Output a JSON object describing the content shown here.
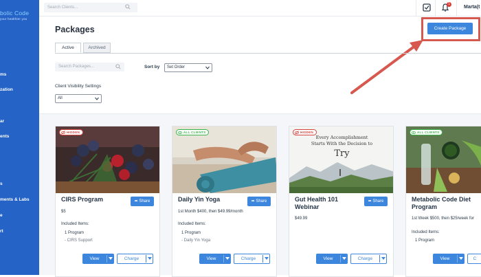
{
  "brand": {
    "logo_text": "bolic Code",
    "tagline": "your healthier you",
    "accent": "#3d86dd",
    "sidebar_color": "#2563c7",
    "annotation_color": "#d6584e"
  },
  "sidebar": {
    "items": [
      {
        "label": "ms"
      },
      {
        "label": "zation"
      },
      {
        "label": "ar"
      },
      {
        "label": "ents"
      },
      {
        "label": "s"
      },
      {
        "label": "ments & Labs"
      },
      {
        "label": "e"
      },
      {
        "label": "rt"
      }
    ]
  },
  "topbar": {
    "search_placeholder": "Search Clients...",
    "notification_count": "1",
    "user_name": "Marta(t"
  },
  "page": {
    "title": "Packages",
    "create_button": "Create Package"
  },
  "tabs": [
    {
      "label": "Active"
    },
    {
      "label": "Archived"
    }
  ],
  "filters": {
    "search_placeholder": "Search Packages...",
    "sort_label": "Sort by",
    "sort_value": "Set Order",
    "visibility_label": "Client Visibility Settings",
    "visibility_value": "All"
  },
  "cards": [
    {
      "badge": "HIDDEN",
      "badge_type": "hidden",
      "title": "CIRS Program",
      "price": "$5",
      "included_label": "Included Items:",
      "items": [
        "1 Program"
      ],
      "subitems": [
        "- CIRS Support"
      ],
      "share": "Share",
      "view": "View",
      "charge": "Charge"
    },
    {
      "badge": "ALL CLIENTS",
      "badge_type": "all",
      "title": "Daily Yin Yoga",
      "price": "1st Month $400, then $49.99/month",
      "included_label": "Included Items:",
      "items": [
        "1 Program"
      ],
      "subitems": [
        "- Daily Yin Yoga"
      ],
      "share": "Share",
      "view": "View",
      "charge": "Charge"
    },
    {
      "badge": "HIDDEN",
      "badge_type": "hidden",
      "title": "Gut Health 101 Webinar",
      "price": "$49.99",
      "included_label": "",
      "items": [],
      "subitems": [],
      "image_text_line1": "Every Accomplishment",
      "image_text_line2": "Starts With the Decision to",
      "image_text_line3": "Try",
      "share": "Share",
      "view": "View",
      "charge": "Charge"
    },
    {
      "badge": "ALL CLIENTS",
      "badge_type": "all",
      "title": "Metabolic Code Diet Program",
      "price": "1st Week $500, then $25/week for",
      "included_label": "Included Items:",
      "items": [
        "1 Program"
      ],
      "subitems": [],
      "share": "",
      "view": "View",
      "charge": "C"
    }
  ]
}
